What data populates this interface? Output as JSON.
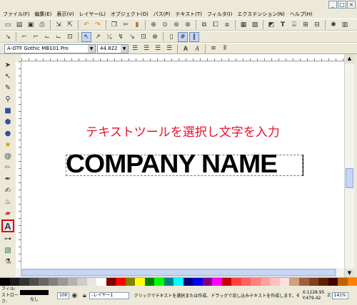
{
  "menu": [
    "ファイル(F)",
    "編集(E)",
    "表示(V)",
    "レイヤー(L)",
    "オブジェクト(O)",
    "パス(P)",
    "テキスト(T)",
    "フィルタ(I)",
    "エクステンション(N)",
    "ヘルプ(H)"
  ],
  "text_toolbar": {
    "font_family": "A-OTF Gothic MB101 Pro",
    "font_size": "44.822"
  },
  "canvas": {
    "instruction_text": "テキストツールを選択し文字を入力",
    "instruction_color": "#e8102a",
    "sample_text": "COMPANY NAME"
  },
  "status": {
    "fill_label": "フィル:",
    "stroke_label": "ストローク:",
    "stroke_value": "なし",
    "opacity_value": "100",
    "layer_value": "-レイヤー1",
    "message": "クリックでテキストを選択または作成、ドラッグで流し込みテキストを作成します。その後に...",
    "cursor_x": "X:1228.95",
    "cursor_y": "Y:479.42",
    "zoom_label": "Z:",
    "zoom_value": "141%"
  },
  "palette": [
    "#000000",
    "#1a1a1a",
    "#333333",
    "#4d4d4d",
    "#666666",
    "#808080",
    "#999999",
    "#b3b3b3",
    "#cccccc",
    "#e6e6e6",
    "#ffffff",
    "#800000",
    "#ff0000",
    "#808000",
    "#ffff00",
    "#008000",
    "#00ff00",
    "#008080",
    "#00ffff",
    "#000080",
    "#0000ff",
    "#800080",
    "#ff00ff",
    "#c80000",
    "#ff4040",
    "#ff6060",
    "#ff8080",
    "#ffa0a0",
    "#ffc0c0",
    "#ffe0e0",
    "#d0a080",
    "#a06040",
    "#804020",
    "#602000",
    "#400000",
    "#c06000",
    "#ff8000"
  ]
}
